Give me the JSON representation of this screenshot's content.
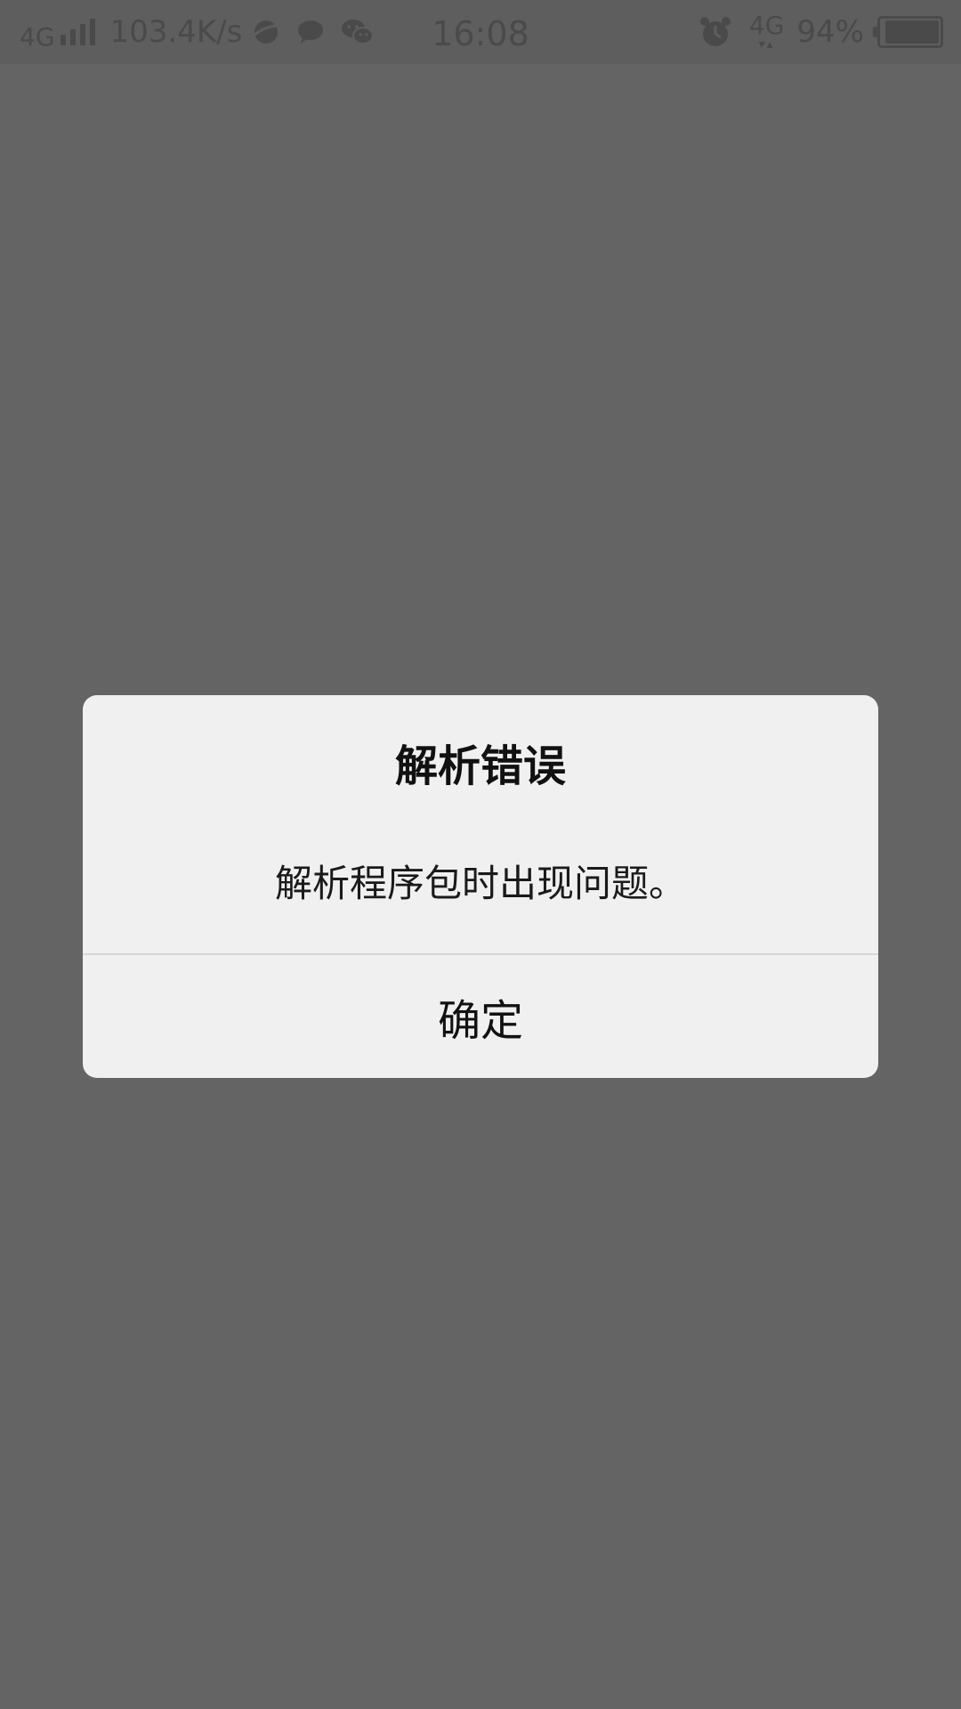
{
  "status_bar": {
    "network_type": "4G",
    "net_speed": "103.4K/s",
    "time": "16:08",
    "data_type": "4G",
    "battery_percent": "94%",
    "battery_level": 0.94,
    "icons": [
      "signal-icon",
      "browser-app-icon",
      "message-app-icon",
      "wechat-icon",
      "alarm-icon",
      "data-activity-icon",
      "battery-icon"
    ]
  },
  "dialog": {
    "title": "解析错误",
    "message": "解析程序包时出现问题。",
    "confirm_label": "确定"
  },
  "colors": {
    "overlay": "#646464",
    "dialog_bg": "#f0f0f0",
    "status_icons": "#4a4a4a"
  }
}
